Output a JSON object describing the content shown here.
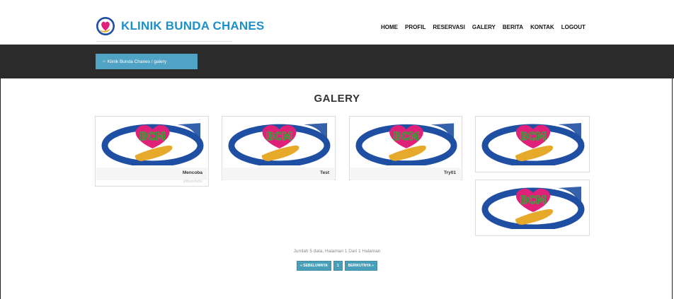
{
  "brand": {
    "name": "KLINIK BUNDA CHANES"
  },
  "nav": {
    "items": [
      {
        "label": "HOME"
      },
      {
        "label": "PROFIL"
      },
      {
        "label": "RESERVASI"
      },
      {
        "label": "GALERY"
      },
      {
        "label": "BERITA"
      },
      {
        "label": "KONTAK"
      },
      {
        "label": "LOGOUT"
      }
    ]
  },
  "breadcrumb": {
    "text": "Klinik Bunda Chanes / galery",
    "icon": "home-icon"
  },
  "page": {
    "title": "GALERY"
  },
  "gallery": {
    "logo_text": "BCM",
    "items": [
      {
        "caption": "Mencoba",
        "sub": "jdlhupuhuhu"
      },
      {
        "caption": "Test"
      },
      {
        "caption": "Try01"
      },
      {
        "caption": ""
      },
      {
        "caption": ""
      }
    ]
  },
  "pagination": {
    "summary": "Jumlah 5 data, Halaman 1 Dari 1 Halaman",
    "prev": "« SEBELUMNYA",
    "current": "1",
    "next": "BERIKUTNYA »"
  },
  "colors": {
    "brand": "#1d90c9",
    "strip": "#2b2b2b",
    "breadcrumb": "#51a3c5",
    "button": "#4a9fb8",
    "logo_pink": "#e0217a",
    "logo_blue": "#1f4fa3",
    "logo_gold": "#e6a92a",
    "logo_green": "#3aa03a"
  }
}
